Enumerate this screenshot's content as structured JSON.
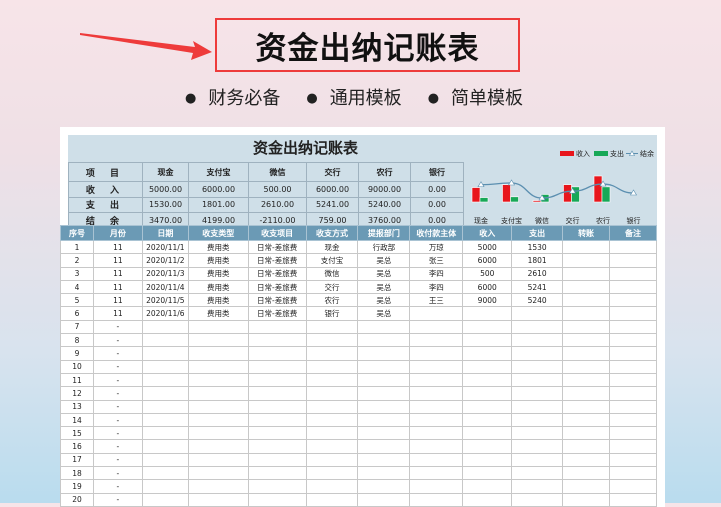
{
  "banner": {
    "title": "资金出纳记账表",
    "bullets": [
      "财务必备",
      "通用模板",
      "简单模板"
    ]
  },
  "sheet": {
    "title": "资金出纳记账表",
    "summary": {
      "header": [
        "项 目",
        "现金",
        "支付宝",
        "微信",
        "交行",
        "农行",
        "银行"
      ],
      "rows": [
        {
          "label": "收 入",
          "values": [
            "5000.00",
            "6000.00",
            "500.00",
            "6000.00",
            "9000.00",
            "0.00"
          ]
        },
        {
          "label": "支 出",
          "values": [
            "1530.00",
            "1801.00",
            "2610.00",
            "5241.00",
            "5240.00",
            "0.00"
          ]
        },
        {
          "label": "结 余",
          "values": [
            "3470.00",
            "4199.00",
            "-2110.00",
            "759.00",
            "3760.00",
            "0.00"
          ]
        }
      ]
    },
    "log": {
      "columns": [
        "序号",
        "月份",
        "日期",
        "收支类型",
        "收支项目",
        "收支方式",
        "提报部门",
        "收付款主体",
        "收入",
        "支出",
        "转账",
        "备注"
      ],
      "rows": [
        [
          "1",
          "11",
          "2020/11/1",
          "费用类",
          "日常-差旅费",
          "现金",
          "行政部",
          "万琼",
          "5000",
          "1530",
          "",
          ""
        ],
        [
          "2",
          "11",
          "2020/11/2",
          "费用类",
          "日常-差旅费",
          "支付宝",
          "吴总",
          "张三",
          "6000",
          "1801",
          "",
          ""
        ],
        [
          "3",
          "11",
          "2020/11/3",
          "费用类",
          "日常-差旅费",
          "微信",
          "吴总",
          "李四",
          "500",
          "2610",
          "",
          ""
        ],
        [
          "4",
          "11",
          "2020/11/4",
          "费用类",
          "日常-差旅费",
          "交行",
          "吴总",
          "李四",
          "6000",
          "5241",
          "",
          ""
        ],
        [
          "5",
          "11",
          "2020/11/5",
          "费用类",
          "日常-差旅费",
          "农行",
          "吴总",
          "王三",
          "9000",
          "5240",
          "",
          ""
        ],
        [
          "6",
          "11",
          "2020/11/6",
          "费用类",
          "日常-差旅费",
          "银行",
          "吴总",
          "",
          "",
          "",
          "",
          ""
        ],
        [
          "7",
          "-",
          "",
          "",
          "",
          "",
          "",
          "",
          "",
          "",
          "",
          ""
        ],
        [
          "8",
          "-",
          "",
          "",
          "",
          "",
          "",
          "",
          "",
          "",
          "",
          ""
        ],
        [
          "9",
          "-",
          "",
          "",
          "",
          "",
          "",
          "",
          "",
          "",
          "",
          ""
        ],
        [
          "10",
          "-",
          "",
          "",
          "",
          "",
          "",
          "",
          "",
          "",
          "",
          ""
        ],
        [
          "11",
          "-",
          "",
          "",
          "",
          "",
          "",
          "",
          "",
          "",
          "",
          ""
        ],
        [
          "12",
          "-",
          "",
          "",
          "",
          "",
          "",
          "",
          "",
          "",
          "",
          ""
        ],
        [
          "13",
          "-",
          "",
          "",
          "",
          "",
          "",
          "",
          "",
          "",
          "",
          ""
        ],
        [
          "14",
          "-",
          "",
          "",
          "",
          "",
          "",
          "",
          "",
          "",
          "",
          ""
        ],
        [
          "15",
          "-",
          "",
          "",
          "",
          "",
          "",
          "",
          "",
          "",
          "",
          ""
        ],
        [
          "16",
          "-",
          "",
          "",
          "",
          "",
          "",
          "",
          "",
          "",
          "",
          ""
        ],
        [
          "17",
          "-",
          "",
          "",
          "",
          "",
          "",
          "",
          "",
          "",
          "",
          ""
        ],
        [
          "18",
          "-",
          "",
          "",
          "",
          "",
          "",
          "",
          "",
          "",
          "",
          ""
        ],
        [
          "19",
          "-",
          "",
          "",
          "",
          "",
          "",
          "",
          "",
          "",
          "",
          ""
        ],
        [
          "20",
          "-",
          "",
          "",
          "",
          "",
          "",
          "",
          "",
          "",
          "",
          ""
        ]
      ]
    }
  },
  "chart_data": {
    "type": "bar",
    "categories": [
      "现金",
      "支付宝",
      "微信",
      "交行",
      "农行",
      "银行"
    ],
    "series": [
      {
        "name": "收入",
        "type": "bar",
        "color": "#e8161c",
        "values": [
          5000,
          6000,
          500,
          6000,
          9000,
          0
        ]
      },
      {
        "name": "支出",
        "type": "bar",
        "color": "#17a857",
        "values": [
          1530,
          1801,
          2610,
          5241,
          5240,
          0
        ]
      },
      {
        "name": "结余",
        "type": "line",
        "color": "#5b8fb0",
        "values": [
          3470,
          4199,
          -2110,
          759,
          3760,
          0
        ]
      }
    ],
    "legend": "top-right"
  }
}
